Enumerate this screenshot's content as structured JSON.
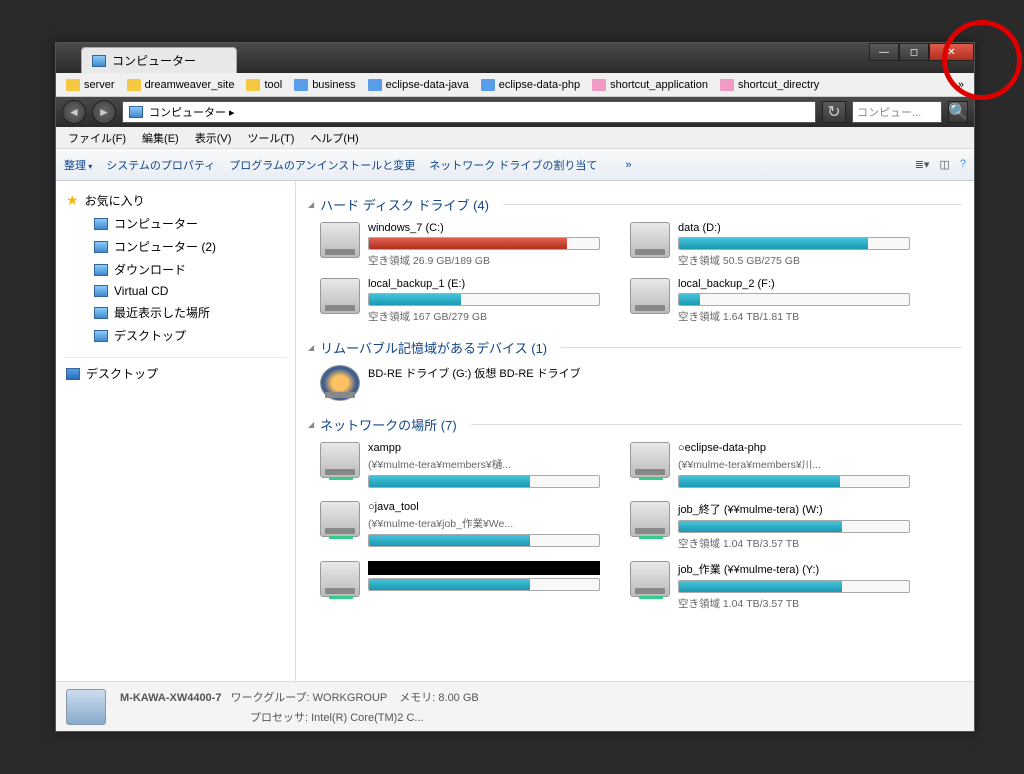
{
  "tab_title": "コンピューター",
  "bookmarks": [
    {
      "label": "server",
      "color": "yellow"
    },
    {
      "label": "dreamweaver_site",
      "color": "yellow"
    },
    {
      "label": "tool",
      "color": "yellow"
    },
    {
      "label": "business",
      "color": "blue"
    },
    {
      "label": "eclipse-data-java",
      "color": "blue"
    },
    {
      "label": "eclipse-data-php",
      "color": "blue"
    },
    {
      "label": "shortcut_application",
      "color": "pink"
    },
    {
      "label": "shortcut_directry",
      "color": "pink"
    }
  ],
  "breadcrumb": "コンピューター  ▸",
  "search_placeholder": "コンピュー...",
  "menus": [
    "ファイル(F)",
    "編集(E)",
    "表示(V)",
    "ツール(T)",
    "ヘルプ(H)"
  ],
  "toolbar": {
    "organize": "整理",
    "items": [
      "システムのプロパティ",
      "プログラムのアンインストールと変更",
      "ネットワーク ドライブの割り当て"
    ],
    "overflow": "»"
  },
  "sidebar": {
    "favorites": "お気に入り",
    "fav_items": [
      "コンピューター",
      "コンピューター (2)",
      "ダウンロード",
      "Virtual CD",
      "最近表示した場所",
      "デスクトップ"
    ],
    "desktop": "デスクトップ"
  },
  "groups": {
    "hdd": "ハード ディスク ドライブ (4)",
    "removable": "リムーバブル記憶域があるデバイス (1)",
    "network": "ネットワークの場所 (7)"
  },
  "hdd": [
    {
      "name": "windows_7 (C:)",
      "sub": "空き領域 26.9 GB/189 GB",
      "fill": 86,
      "red": true
    },
    {
      "name": "data (D:)",
      "sub": "空き領域 50.5 GB/275 GB",
      "fill": 82,
      "red": false
    },
    {
      "name": "local_backup_1 (E:)",
      "sub": "空き領域 167 GB/279 GB",
      "fill": 40,
      "red": false
    },
    {
      "name": "local_backup_2 (F:)",
      "sub": "空き領域 1.64 TB/1.81 TB",
      "fill": 9,
      "red": false
    }
  ],
  "removable": [
    {
      "name": "BD-RE ドライブ (G:) 仮想 BD-RE ドライブ"
    }
  ],
  "network": [
    {
      "name": "xampp",
      "sub": "(¥¥mulme-tera¥members¥樋...",
      "fill": 70
    },
    {
      "name": "○eclipse-data-php",
      "sub": "(¥¥mulme-tera¥members¥川...",
      "fill": 70
    },
    {
      "name": "○java_tool",
      "sub": "(¥¥mulme-tera¥job_作業¥We...",
      "fill": 70
    },
    {
      "name": "job_終了 (¥¥mulme-tera) (W:)",
      "sub": "空き領域 1.04 TB/3.57 TB",
      "fill": 71
    },
    {
      "name": "REDACTED",
      "sub": "",
      "fill": 70,
      "redact": true
    },
    {
      "name": "job_作業 (¥¥mulme-tera) (Y:)",
      "sub": "空き領域 1.04 TB/3.57 TB",
      "fill": 71
    }
  ],
  "status": {
    "name": "M-KAWA-XW4400-7",
    "wg_label": "ワークグループ:",
    "wg": "WORKGROUP",
    "mem_label": "メモリ:",
    "mem": "8.00 GB",
    "cpu_label": "プロセッサ:",
    "cpu": "Intel(R) Core(TM)2 C..."
  }
}
